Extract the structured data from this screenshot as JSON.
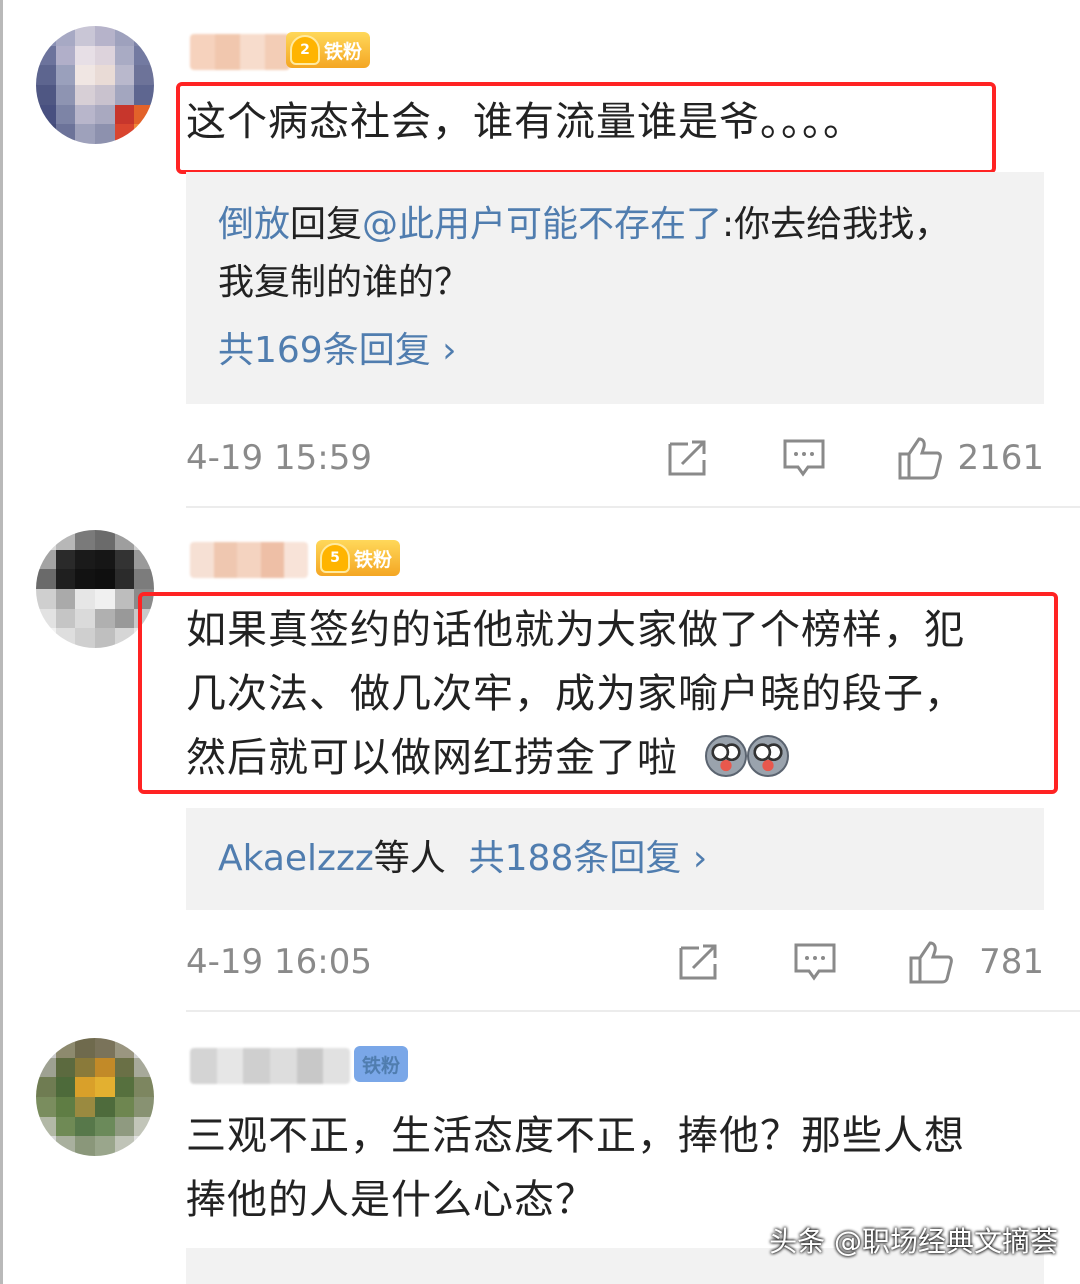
{
  "comments": [
    {
      "badge": "铁粉",
      "badge_level": "2",
      "text": "这个病态社会，谁有流量谁是爷。。。。",
      "reply": {
        "author": "倒放",
        "reply_word": "回复",
        "mention": "@此用户可能不存在了",
        "text_line1": ":你去给我找，",
        "text_line2": "我复制的谁的？",
        "count_label": "共169条回复 ›"
      },
      "time": "4-19 15:59",
      "likes": "2161"
    },
    {
      "badge": "铁粉",
      "badge_level": "5",
      "text_line1": "如果真签约的话他就为大家做了个榜样，犯",
      "text_line2": "几次法、做几次牢，成为家喻户晓的段子，",
      "text_line3": "然后就可以做网红捞金了啦",
      "reply": {
        "author": "Akaelzzz",
        "others": "等人",
        "count_label": "共188条回复 ›"
      },
      "time": "4-19 16:05",
      "likes": "781"
    },
    {
      "badge": "铁粉",
      "text_line1": "三观不正，生活态度不正，捧他？那些人想",
      "text_line2": "捧他的人是什么心态？"
    }
  ],
  "icon_names": [
    "share-icon",
    "comment-icon",
    "like-icon"
  ],
  "colors": {
    "highlight_border": "#ff2323",
    "link_blue": "#507daf",
    "meta_gray": "#8a8a8a",
    "reply_bg": "#f2f2f2"
  },
  "watermark": "头条 @职场经典文摘荟"
}
